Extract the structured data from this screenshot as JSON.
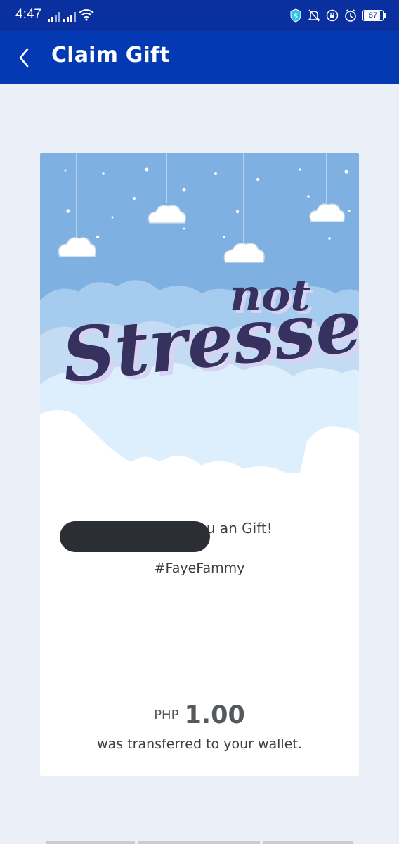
{
  "status_bar": {
    "time": "4:47",
    "battery": "87",
    "icons": [
      "signal-icon",
      "signal-icon",
      "wifi-icon",
      "vpn-shield-icon",
      "notifications-off-icon",
      "lock-icon",
      "alarm-icon",
      "battery-icon"
    ]
  },
  "app_bar": {
    "title": "Claim Gift",
    "back_icon": "chevron-left-icon",
    "background": "#0339b3"
  },
  "gift_card": {
    "artwork": {
      "word_top": "not",
      "word_main": "Stressed",
      "sky_color": "#7fb0e2",
      "lettering_color": "#36315e"
    },
    "sender_message": "sent you an Gift!",
    "hashtag": "#FayeFammy",
    "currency": "PHP",
    "amount": "1.00",
    "transfer_note": "was transferred to your wallet."
  }
}
